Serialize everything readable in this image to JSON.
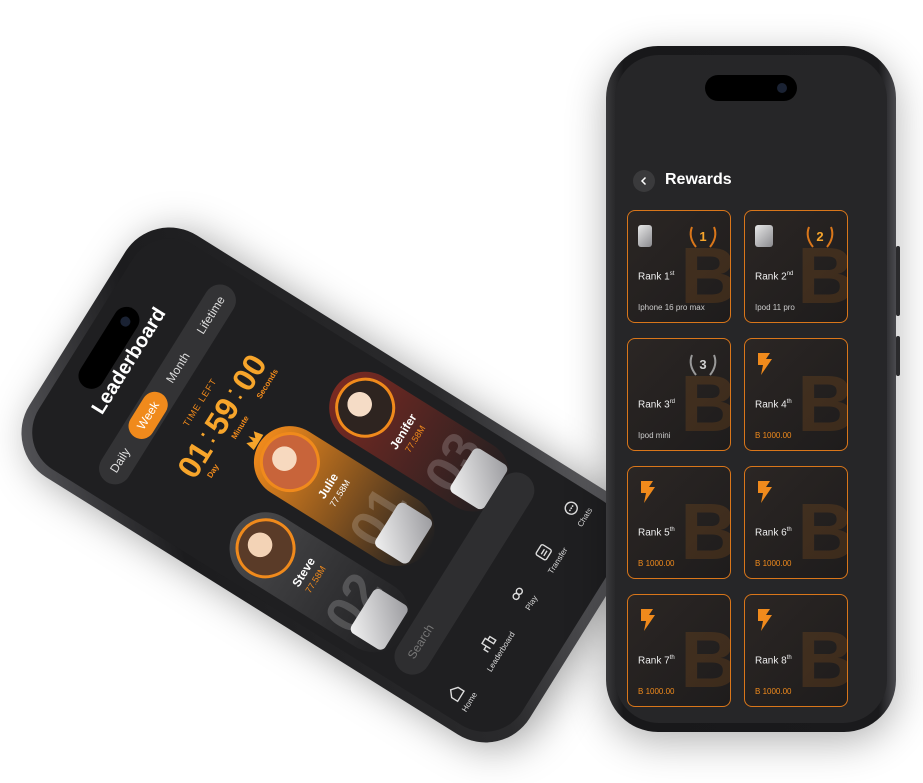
{
  "leaderboard": {
    "title": "Leaderboard",
    "periods": [
      "Daily",
      "Week",
      "Month",
      "Lifetime"
    ],
    "active_period": "Week",
    "time_left_caption": "TIME LEFT",
    "timer": {
      "day": "01",
      "minute": "59",
      "seconds": "00",
      "day_label": "Day",
      "minute_label": "Minute",
      "seconds_label": "Seconds"
    },
    "podium": [
      {
        "name": "Steve",
        "score": "77.58M",
        "rank": "02"
      },
      {
        "name": "Julie",
        "score": "77.58M",
        "rank": "01"
      },
      {
        "name": "Jenifer",
        "score": "77.58M",
        "rank": "03"
      }
    ],
    "search_placeholder": "Search",
    "tabbar": [
      {
        "label": "Home",
        "icon": "home-icon"
      },
      {
        "label": "Leaderboard",
        "icon": "leaderboard-icon"
      },
      {
        "label": "Play",
        "icon": "play-icon"
      },
      {
        "label": "Transfer",
        "icon": "transfer-icon"
      },
      {
        "label": "Chats",
        "icon": "chat-icon"
      }
    ]
  },
  "rewards": {
    "title": "Rewards",
    "cards": [
      {
        "rank_base": "Rank 1",
        "rank_sup": "st",
        "prize": "Iphone 16 pro max",
        "badge": "1"
      },
      {
        "rank_base": "Rank 2",
        "rank_sup": "nd",
        "prize": "Ipod 11 pro",
        "badge": "2"
      },
      {
        "rank_base": "Rank 3",
        "rank_sup": "rd",
        "prize": "Ipod mini",
        "badge": "3"
      },
      {
        "rank_base": "Rank 4",
        "rank_sup": "th",
        "amount": "1000.00"
      },
      {
        "rank_base": "Rank 5",
        "rank_sup": "th",
        "amount": "1000.00"
      },
      {
        "rank_base": "Rank 6",
        "rank_sup": "th",
        "amount": "1000.00"
      },
      {
        "rank_base": "Rank 7",
        "rank_sup": "th",
        "amount": "1000.00"
      },
      {
        "rank_base": "Rank 8",
        "rank_sup": "th",
        "amount": "1000.00"
      }
    ]
  },
  "colors": {
    "accent": "#f08a1c",
    "background": "#262628"
  }
}
